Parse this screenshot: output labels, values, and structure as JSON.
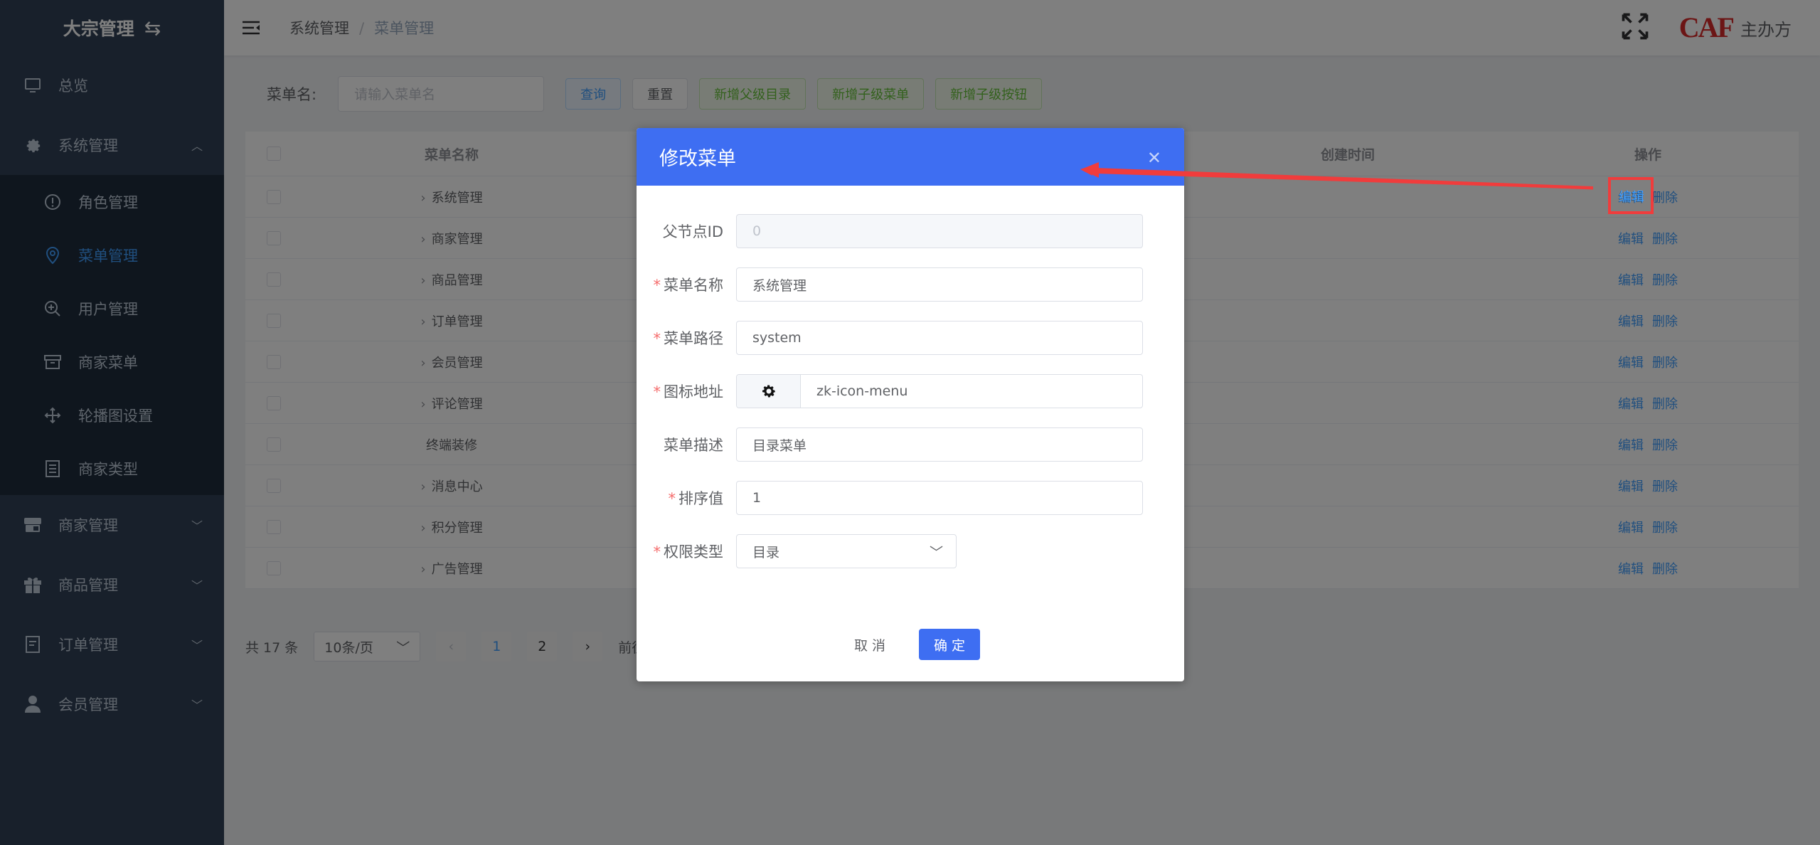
{
  "sidebar": {
    "title": "大宗管理",
    "items": [
      {
        "label": "总览",
        "icon": "monitor-icon"
      },
      {
        "label": "系统管理",
        "icon": "gear-icon",
        "expanded": true,
        "children": [
          {
            "label": "角色管理",
            "icon": "alert-circle-icon"
          },
          {
            "label": "菜单管理",
            "icon": "location-pin-icon",
            "active": true
          },
          {
            "label": "用户管理",
            "icon": "zoom-in-icon"
          },
          {
            "label": "商家菜单",
            "icon": "archive-box-icon"
          },
          {
            "label": "轮播图设置",
            "icon": "move-arrows-icon"
          },
          {
            "label": "商家类型",
            "icon": "document-list-icon"
          }
        ]
      },
      {
        "label": "商家管理",
        "icon": "store-icon"
      },
      {
        "label": "商品管理",
        "icon": "gift-icon"
      },
      {
        "label": "订单管理",
        "icon": "order-list-icon"
      },
      {
        "label": "会员管理",
        "icon": "user-icon"
      }
    ]
  },
  "header": {
    "breadcrumb": [
      "系统管理",
      "菜单管理"
    ],
    "brand_logo": "CAF",
    "host_label": "主办方"
  },
  "search": {
    "label": "菜单名:",
    "placeholder": "请输入菜单名",
    "query_btn": "查询",
    "reset_btn": "重置",
    "add_parent_btn": "新增父级目录",
    "add_child_menu_btn": "新增子级菜单",
    "add_child_button_btn": "新增子级按钮"
  },
  "table": {
    "columns": {
      "name": "菜单名称",
      "created": "创建时间",
      "ops": "操作"
    },
    "edit_label": "编辑",
    "delete_label": "删除",
    "rows": [
      {
        "name": "系统管理",
        "expandable": true
      },
      {
        "name": "商家管理",
        "expandable": true
      },
      {
        "name": "商品管理",
        "expandable": true
      },
      {
        "name": "订单管理",
        "expandable": true
      },
      {
        "name": "会员管理",
        "expandable": true
      },
      {
        "name": "评论管理",
        "expandable": true
      },
      {
        "name": "终端装修",
        "expandable": false
      },
      {
        "name": "消息中心",
        "expandable": true
      },
      {
        "name": "积分管理",
        "expandable": true
      },
      {
        "name": "广告管理",
        "expandable": true
      }
    ]
  },
  "pager": {
    "total": "共 17 条",
    "size": "10条/页",
    "pages": [
      "1",
      "2"
    ],
    "current": "1",
    "goto": "前往"
  },
  "dialog": {
    "title": "修改菜单",
    "fields": {
      "parent_id": {
        "label": "父节点ID",
        "value": "0"
      },
      "name": {
        "label": "菜单名称",
        "value": "系统管理"
      },
      "path": {
        "label": "菜单路径",
        "value": "system"
      },
      "icon": {
        "label": "图标地址",
        "value": "zk-icon-menu"
      },
      "desc": {
        "label": "菜单描述",
        "value": "目录菜单"
      },
      "sort": {
        "label": "排序值",
        "value": "1"
      },
      "perm": {
        "label": "权限类型",
        "value": "目录"
      }
    },
    "cancel": "取 消",
    "ok": "确 定"
  },
  "colors": {
    "sidebar": "#304156",
    "accent": "#409eff",
    "dialog_header": "#3e6ef2",
    "annotation": "#f03c3c"
  }
}
